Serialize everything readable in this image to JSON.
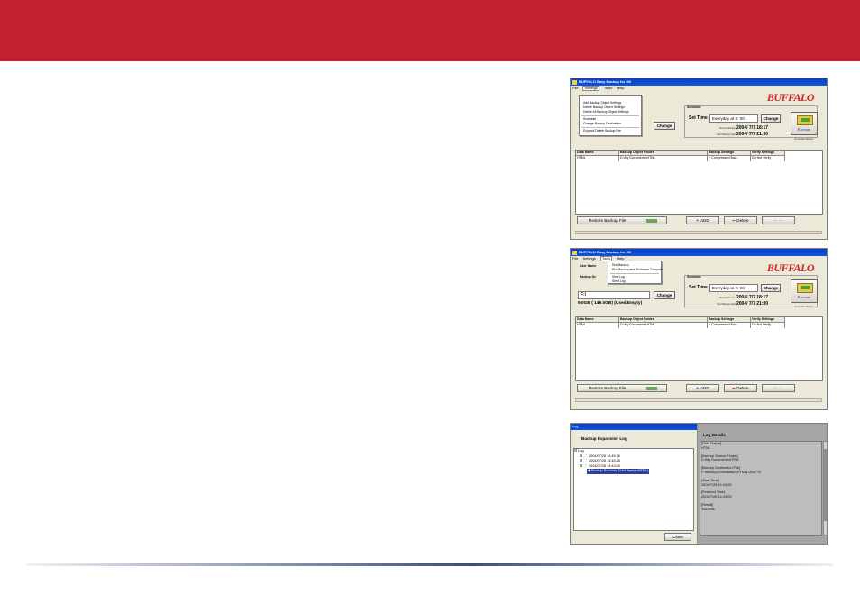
{
  "page": {
    "accent": "#c0202f",
    "rule_color": "#3a4d7a"
  },
  "app": {
    "title": "BUFFALO Easy Backup for HD",
    "logo": "BUFFALO",
    "logo_color": "#d8222a"
  },
  "menus": {
    "file": "File",
    "settings": "Settings",
    "tools": "Tools",
    "help": "Help"
  },
  "settings_menu": {
    "items": [
      "Add Backup Object Settings",
      "Delete Backup Object Settings",
      "Delete All Backup Object Settings",
      "Schedule",
      "Change Backup Destination",
      "Expand/ Delete Backup File"
    ]
  },
  "tools_menu": {
    "items": [
      "Run Backup",
      "Run Backup and Shutdown Computer",
      "View Log",
      "Send Log"
    ]
  },
  "schedule": {
    "title": "Schedule",
    "set_time_label": "Set Time",
    "set_time_value": "Everyday at 9: 00",
    "change_label": "Change",
    "last_label": "Normal Backup",
    "last_value": "2004/ 7/7 18:17",
    "next_label": "Next Backup Start",
    "next_value": "2004/ 7/7 21:00"
  },
  "execute": {
    "label": "Execute",
    "caption": "Immediate Backup"
  },
  "destination": {
    "user_label": "User Name",
    "backup_label": "Backup De",
    "drive": "F:\\",
    "change_label": "Change",
    "capacity": "9.0GB ( 149.0GB)  (Used/Empty)"
  },
  "grid": {
    "headers": [
      "Data Name",
      "Backup Object Folder",
      "Backup Settings",
      "Verify Settings"
    ],
    "rows": [
      [
        "HTML",
        "D:\\My Documents\\HTML",
        "+ Compressed Bac...",
        "Do Not Verify"
      ]
    ]
  },
  "bottom": {
    "restore": "Restore Backup File",
    "add": "ADD",
    "delete": "Delete"
  },
  "log": {
    "window_title": "Log",
    "left_title": "Backup Expansion Log",
    "root": "Log",
    "entries": [
      "2004/07/28 14:45:36",
      "2004/07/28 14:45:28",
      "2004/07/28 14:43:05"
    ],
    "selected": "Backup Success (Data Name=HTML)",
    "close": "Close",
    "right_title": "Log Details",
    "details": [
      "[Data Name]",
      "HTML",
      "",
      "[Backup Source Folder]",
      "D:\\My Documents\\HTML",
      "",
      "[Backup Destination File]",
      "F:\\Backup\\Oriondaisu\\[HTML]\\00\\c770",
      "",
      "[Start Time]",
      "2004/7/28 14:43:05",
      "",
      "[Finished Time]",
      "2004/7/28 14:43:05",
      "",
      "[Result]",
      "Success"
    ]
  }
}
